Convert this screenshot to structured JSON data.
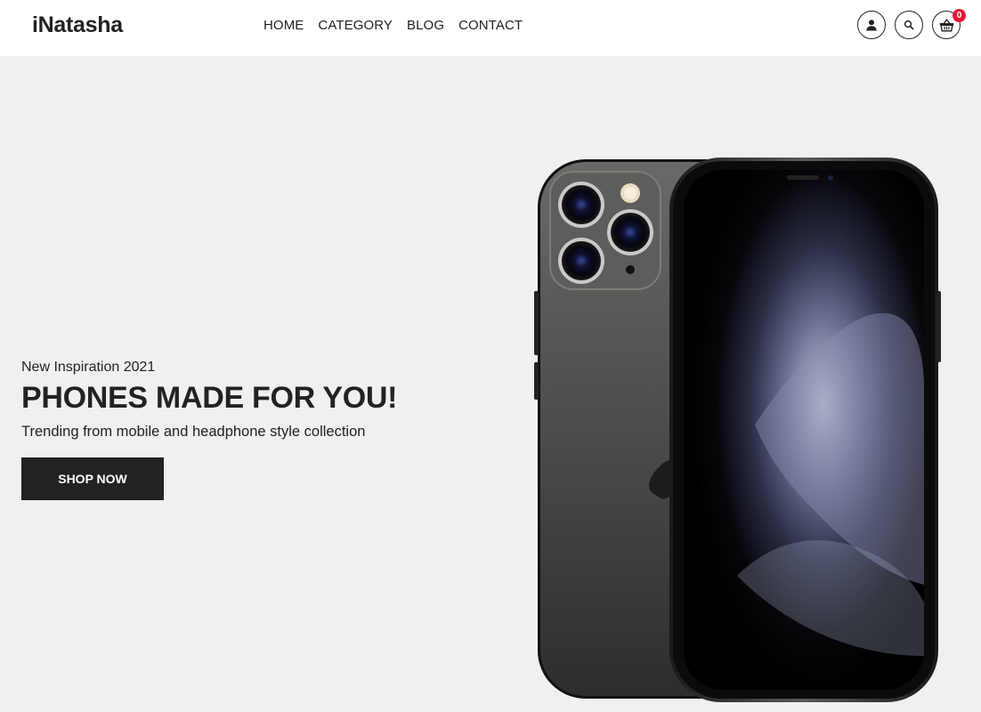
{
  "header": {
    "logo": "iNatasha",
    "nav": [
      "HOME",
      "CATEGORY",
      "BLOG",
      "CONTACT"
    ],
    "icons": [
      "user-icon",
      "search-icon",
      "basket-icon"
    ],
    "cart_count": "0",
    "badge_color": "#e2173a"
  },
  "hero": {
    "eyebrow": "New Inspiration 2021",
    "headline": "PHONES MADE FOR YOU!",
    "subline": "Trending from mobile and headphone style collection",
    "cta_label": "SHOP NOW",
    "background": "#f0f0f0",
    "button_color": "#222222"
  }
}
